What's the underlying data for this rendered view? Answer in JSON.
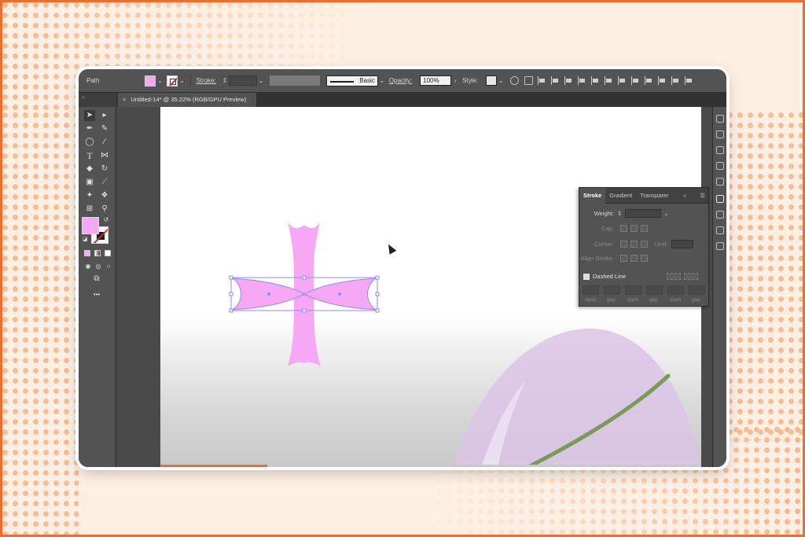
{
  "colors": {
    "orange_accent": "#f26b2a",
    "fill_pink": "#f7a8f5",
    "selection_blue": "#8a8cf5",
    "leaf_purple": "#d9c4e6",
    "stem_green": "#7a9a55"
  },
  "control_bar": {
    "object_type": "Path",
    "stroke_label": "Stroke:",
    "brush_label": "Basic",
    "opacity_label": "Opacity:",
    "opacity_value": "100%",
    "style_label": "Style:"
  },
  "document_tab": {
    "title": "Untitled-14* @ 35.22% (RGB/GPU Preview)",
    "close_icon": "×"
  },
  "toolbar": {
    "tools": [
      "selection-tool",
      "direct-selection-tool",
      "pen-tool",
      "curvature-tool",
      "ellipse-tool",
      "paintbrush-tool",
      "type-tool",
      "width-tool",
      "eraser-tool",
      "rotate-tool",
      "gradient-tool",
      "eyedropper-tool",
      "shape-builder-tool",
      "symbol-sprayer-tool",
      "artboard-tool",
      "zoom-tool"
    ],
    "more": "•••"
  },
  "stroke_panel": {
    "tabs": [
      "Stroke",
      "Gradient",
      "Transparer"
    ],
    "more": "»",
    "weight_label": "Weight:",
    "cap_label": "Cap:",
    "corner_label": "Corner:",
    "limit_label": "Limit:",
    "align_label": "Align Stroke:",
    "dashed_label": "Dashed Line",
    "dash_labels": [
      "dash",
      "gap",
      "dash",
      "gap",
      "dash",
      "gap"
    ]
  }
}
